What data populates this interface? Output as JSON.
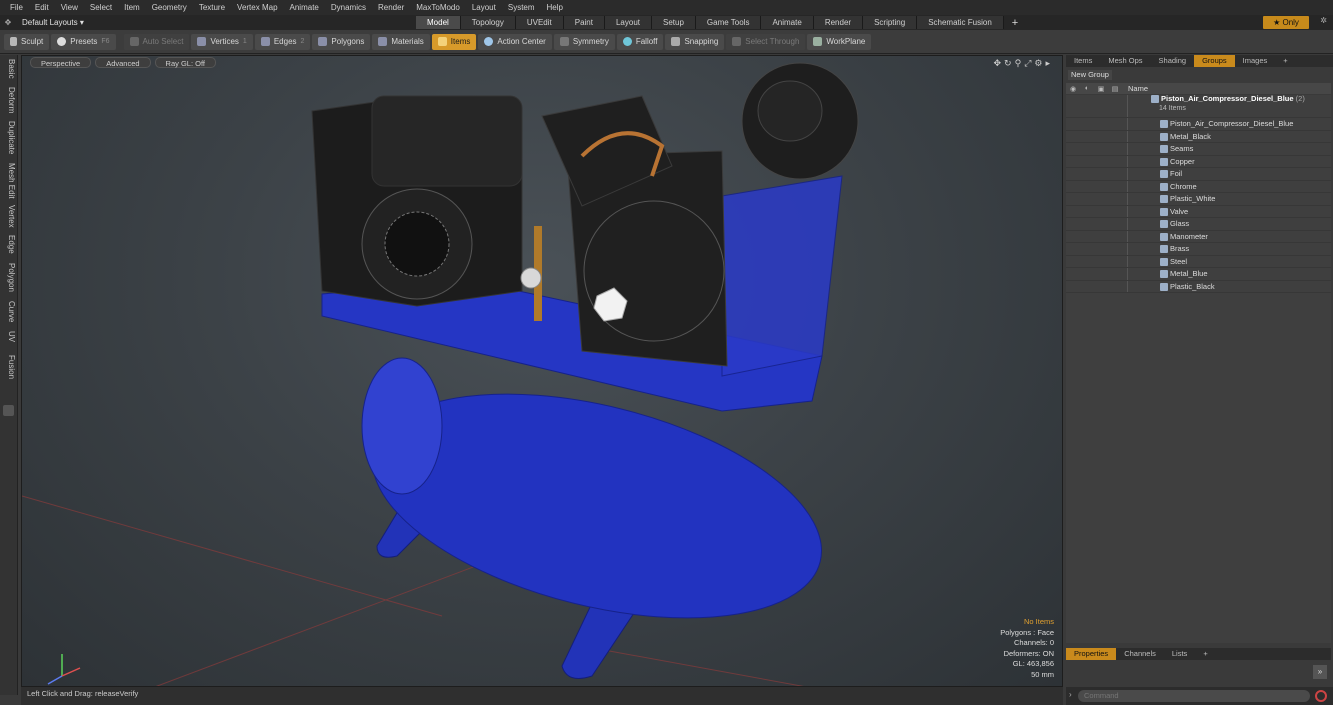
{
  "menu": [
    "File",
    "Edit",
    "View",
    "Select",
    "Item",
    "Geometry",
    "Texture",
    "Vertex Map",
    "Animate",
    "Dynamics",
    "Render",
    "MaxToModo",
    "Layout",
    "System",
    "Help"
  ],
  "layout": {
    "selector": "Default Layouts ▾",
    "tabs": [
      "Model",
      "Topology",
      "UVEdit",
      "Paint",
      "Layout",
      "Setup",
      "Game Tools",
      "Animate",
      "Render",
      "Scripting",
      "Schematic Fusion"
    ],
    "only": "★  Only"
  },
  "toolbar": {
    "sculpt": "Sculpt",
    "presets": "Presets",
    "presets_key": "F6",
    "auto_select": "Auto Select",
    "vertices": "Vertices",
    "vertices_key": "1",
    "edges": "Edges",
    "edges_key": "2",
    "polygons": "Polygons",
    "materials": "Materials",
    "items": "Items",
    "action_center": "Action Center",
    "symmetry": "Symmetry",
    "falloff": "Falloff",
    "snapping": "Snapping",
    "select_through": "Select Through",
    "workplane": "WorkPlane"
  },
  "lefttabs": [
    "Basic",
    "Deform",
    "Duplicate",
    "Mesh Edit",
    "Vertex",
    "Edge",
    "Polygon",
    "Curve",
    "UV",
    "Fusion"
  ],
  "viewport": {
    "view": "Perspective",
    "shading": "Advanced",
    "raygl": "Ray GL: Off",
    "stats": {
      "noitems": "No Items",
      "polygons": "Polygons : Face",
      "channels": "Channels: 0",
      "deformers": "Deformers: ON",
      "gl": "GL: 463,856",
      "size": "50 mm"
    }
  },
  "status": "Left Click and Drag:  releaseVerify",
  "rpanel": {
    "tabs": [
      "Items",
      "Mesh Ops",
      "Shading",
      "Groups",
      "Images"
    ],
    "new_group": "New Group",
    "header": "Name",
    "group": {
      "name": "Piston_Air_Compressor_Diesel_Blue",
      "count": "(2)",
      "sub": "14 Items"
    },
    "items": [
      "Piston_Air_Compressor_Diesel_Blue",
      "Metal_Black",
      "Seams",
      "Copper",
      "Foil",
      "Chrome",
      "Plastic_White",
      "Valve",
      "Glass",
      "Manometer",
      "Brass",
      "Steel",
      "Metal_Blue",
      "Plastic_Black"
    ],
    "bottom_tabs": [
      "Properties",
      "Channels",
      "Lists"
    ],
    "command_placeholder": "Command"
  },
  "colors": {
    "accent": "#d79a2a",
    "tank": "#1f2fb5",
    "engine": "#1c1c1c"
  }
}
